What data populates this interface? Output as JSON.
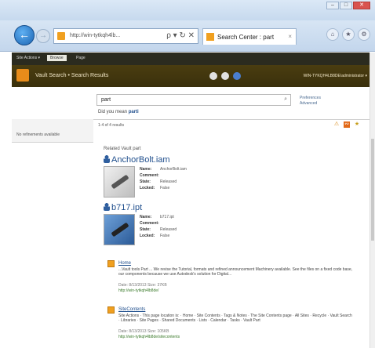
{
  "browser": {
    "url": "http://win-tytkqh4lb...",
    "address_actions": "ρ ▾ ↻ ✕",
    "tab_title": "Search Center : part",
    "tab_close": "×",
    "window_buttons": [
      "–",
      "□",
      "✕"
    ],
    "tools": [
      "⌂",
      "★",
      "⚙"
    ],
    "icons": {
      "back": "back-arrow-icon",
      "forward": "forward-arrow-icon"
    }
  },
  "topbar": {
    "menu": "Site Actions ▾",
    "active_tab": "Browse",
    "page_tab": "Page"
  },
  "ribbon": {
    "breadcrumb": "Vault Search • Search Results",
    "user": "WIN-TYKQH4LB8DE\\administrator ▾"
  },
  "search": {
    "value": "part",
    "mag": "⌕",
    "links": [
      "Preferences",
      "Advanced"
    ]
  },
  "did_you_mean": {
    "prefix": "Did you mean",
    "suggestion": "parti"
  },
  "leftnav": {
    "text": "No refinements available"
  },
  "results_count": "1-4 of 4 results",
  "related_label": "Related Vault part",
  "vault_results": [
    {
      "title": "AnchorBolt.iam",
      "props": [
        {
          "k": "Name:",
          "v": "AnchorBolt.iam"
        },
        {
          "k": "Comment:",
          "v": ""
        },
        {
          "k": "State:",
          "v": "Released"
        },
        {
          "k": "Locked:",
          "v": "False"
        }
      ]
    },
    {
      "title": "b717.ipt",
      "props": [
        {
          "k": "Name:",
          "v": "b717.ipt"
        },
        {
          "k": "Comment:",
          "v": ""
        },
        {
          "k": "State:",
          "v": "Released"
        },
        {
          "k": "Locked:",
          "v": "False"
        }
      ]
    }
  ],
  "hits": [
    {
      "title": "Home",
      "desc": "...Vault tools Part ... We revise the Tutorial, formats and refined announcement Machinery available. See the files on a fixed code base, our components because we use Autodesk's solution for Digital...",
      "meta": "Date: 8/13/2013  Size: 37KB",
      "url": "http://win-tytkqh4lb8de/"
    },
    {
      "title": "SiteContents",
      "desc": "Site Actions · This page location is: · Home · Site Contents · Tags & Notes · The Site Contents page · All Sites · Recycle · Vault Search · Libraries · Site Pages · Shared Documents · Lists · Calendar · Tasks · Vault Part",
      "meta": "Date: 8/13/2013  Size: 105KB",
      "url": "http://win-tytkqh4lb8de/sitecontents"
    }
  ]
}
